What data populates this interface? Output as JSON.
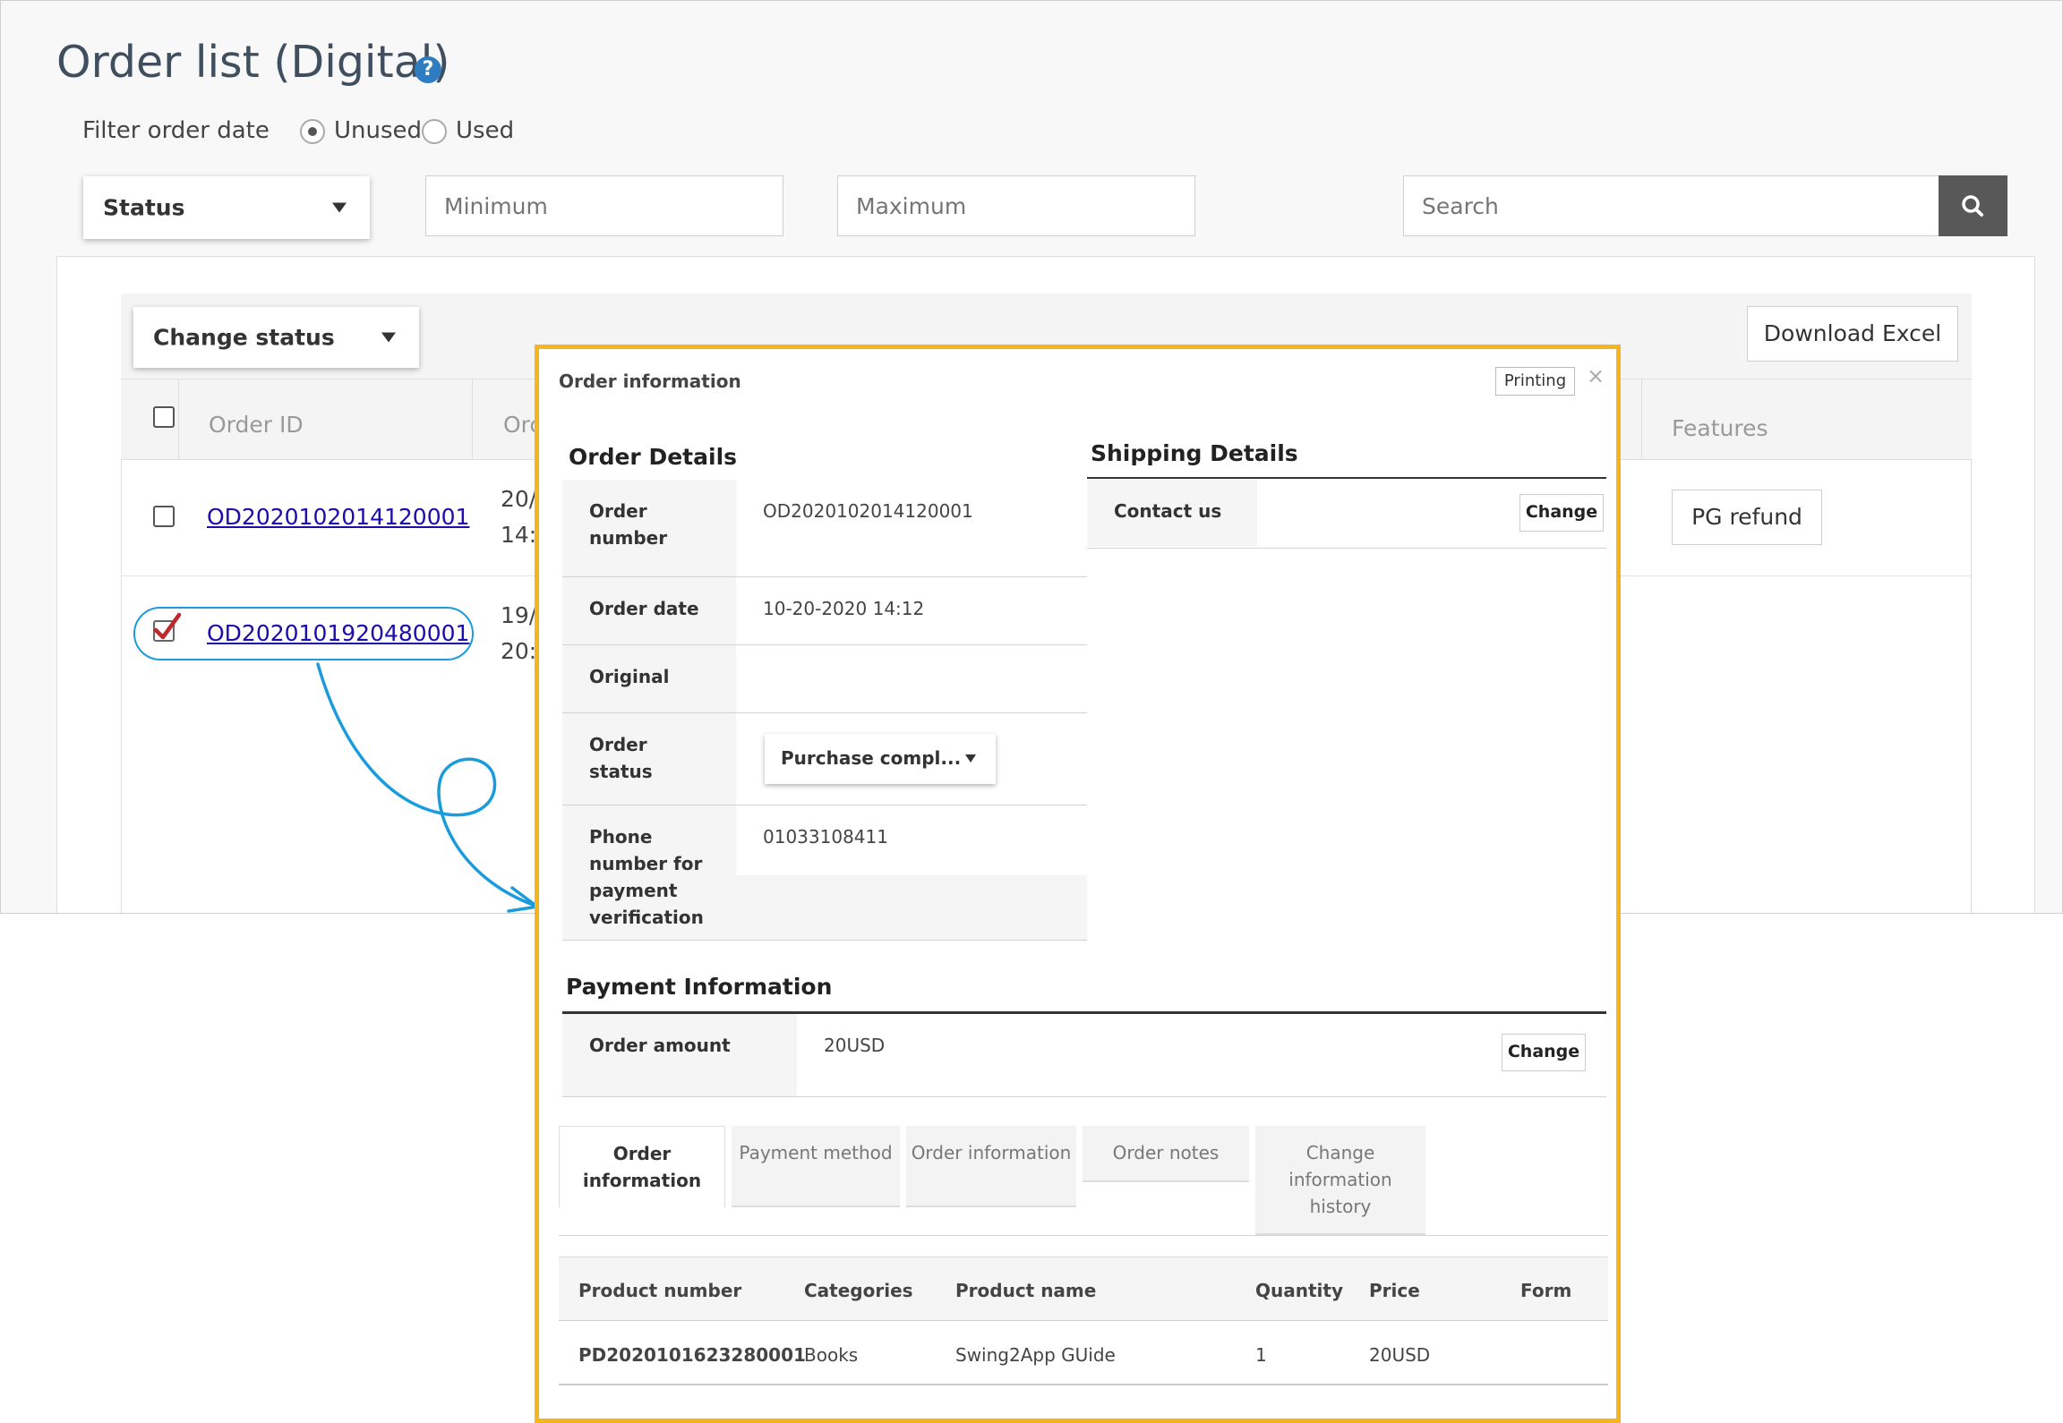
{
  "page": {
    "title": "Order list (Digital)",
    "help_icon": "?",
    "filter_label": "Filter order date",
    "radio_options": [
      "Unused",
      "Used"
    ],
    "radio_selected": "Unused",
    "status_dropdown": "Status",
    "minimum_placeholder": "Minimum",
    "maximum_placeholder": "Maximum",
    "search_placeholder": "Search",
    "change_status_dropdown": "Change status",
    "download_excel": "Download Excel",
    "columns": [
      "Order ID",
      "Orc",
      "Features"
    ],
    "rows": [
      {
        "order_id": "OD202010201412000​1",
        "date_line1": "20/",
        "date_line2": "14:",
        "checked": false,
        "feature": "PG refund"
      },
      {
        "order_id": "OD2020101920480001",
        "date_line1": "19/",
        "date_line2": "20:",
        "checked": true,
        "feature": ""
      }
    ]
  },
  "modal": {
    "title": "Order information",
    "printing": "Printing",
    "close": "×",
    "order_details": {
      "heading": "Order Details",
      "rows": [
        {
          "label": "Order number",
          "value": "OD2020102014120001"
        },
        {
          "label": "Order date",
          "value": "10-20-2020 14:12"
        },
        {
          "label": "Original",
          "value": ""
        },
        {
          "label": "Order status",
          "value": "Purchase compl..."
        },
        {
          "label": "Phone number for payment verification",
          "value": "01033108411"
        }
      ]
    },
    "shipping": {
      "heading": "Shipping Details",
      "contact_label": "Contact us",
      "change_label": "Change"
    },
    "payment": {
      "heading": "Payment Information",
      "amount_label": "Order amount",
      "amount_value": "20USD",
      "change_label": "Change"
    },
    "tabs": [
      "Order information",
      "Payment method",
      "Order information",
      "Order notes",
      "Change information history"
    ],
    "active_tab": 0,
    "product_table": {
      "headers": [
        "Product number",
        "Categories",
        "Product name",
        "Quantity",
        "Price",
        "Form"
      ],
      "rows": [
        [
          "PD2020101623280001",
          "Books",
          "Swing2App GUide",
          "1",
          "20USD",
          ""
        ]
      ]
    }
  },
  "colors": {
    "modal_border": "#f6b51d",
    "highlight": "#1a9cdc",
    "link": "#1a0dab",
    "help_icon": "#2f7cc1"
  }
}
